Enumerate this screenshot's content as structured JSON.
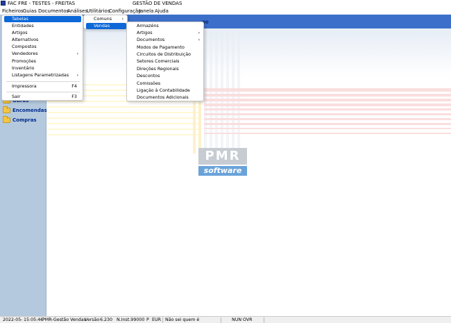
{
  "window": {
    "title": "FAC FRE - TESTES - FREITAS",
    "center_title": "GESTÃO DE VENDAS"
  },
  "menubar": {
    "items": [
      "Ficheiros",
      "Guias",
      "Documentos",
      "Análises",
      "Utilitários",
      "Configuração",
      "Janela",
      "Ajuda"
    ]
  },
  "menu_ficheiros": {
    "items": [
      {
        "label": "Tabelas",
        "active": true,
        "submenu": false
      },
      {
        "label": "Entidades",
        "submenu": false
      },
      {
        "label": "Artigos",
        "submenu": false
      },
      {
        "label": "Alternativos",
        "submenu": false
      },
      {
        "label": "Compostos",
        "submenu": false
      },
      {
        "label": "Vendedores",
        "submenu": true
      },
      {
        "label": "Promoções",
        "submenu": false
      },
      {
        "label": "Inventário",
        "submenu": false
      },
      {
        "label": "Listagens Parametrizadas",
        "submenu": true
      }
    ],
    "printer_label": "Impressora",
    "printer_shortcut": "F4",
    "exit_label": "Sair",
    "exit_shortcut": "F3"
  },
  "menu_tabelas": {
    "items": [
      {
        "label": "Comuns",
        "submenu": true
      },
      {
        "label": "Vendas",
        "submenu": true,
        "active": true
      }
    ]
  },
  "menu_vendas": {
    "items": [
      {
        "label": "Armazéns",
        "submenu": false
      },
      {
        "label": "Artigos",
        "submenu": true
      },
      {
        "label": "Documentos",
        "submenu": true
      },
      {
        "label": "Modos de Pagamento",
        "submenu": false
      },
      {
        "label": "Circuitos de Distribuição",
        "submenu": false
      },
      {
        "label": "Setores Comerciais",
        "submenu": false
      },
      {
        "label": "Direções Regionais",
        "submenu": false
      },
      {
        "label": "Descontos",
        "submenu": false
      },
      {
        "label": "Comissões",
        "submenu": false
      },
      {
        "label": "Ligação à Contabilidade",
        "submenu": false
      },
      {
        "label": "Documentos Adicionais",
        "submenu": false
      }
    ]
  },
  "sidebar": {
    "groups": [
      {
        "label": "Obras",
        "icon": "folder-icon"
      },
      {
        "label": "Encomendas",
        "icon": "folder-icon"
      },
      {
        "label": "Compras",
        "icon": "folder-icon"
      }
    ]
  },
  "header_text": "/00",
  "logo": {
    "top": "PMR",
    "bottom": "software"
  },
  "status": {
    "date": "2022-05-",
    "time": "15:05:4€",
    "app": "PMR-Gestão Vendas",
    "version_label": "Versão",
    "version": "6.230",
    "inst": "N.Inst.99000",
    "p": "P",
    "currency": "EUR",
    "user": "Não sei quem é",
    "mode": "NUN OVR"
  },
  "colors": {
    "sidebar": "#b4c9de",
    "header": "#3c6fc9",
    "menu_active": "#0d68d8"
  }
}
